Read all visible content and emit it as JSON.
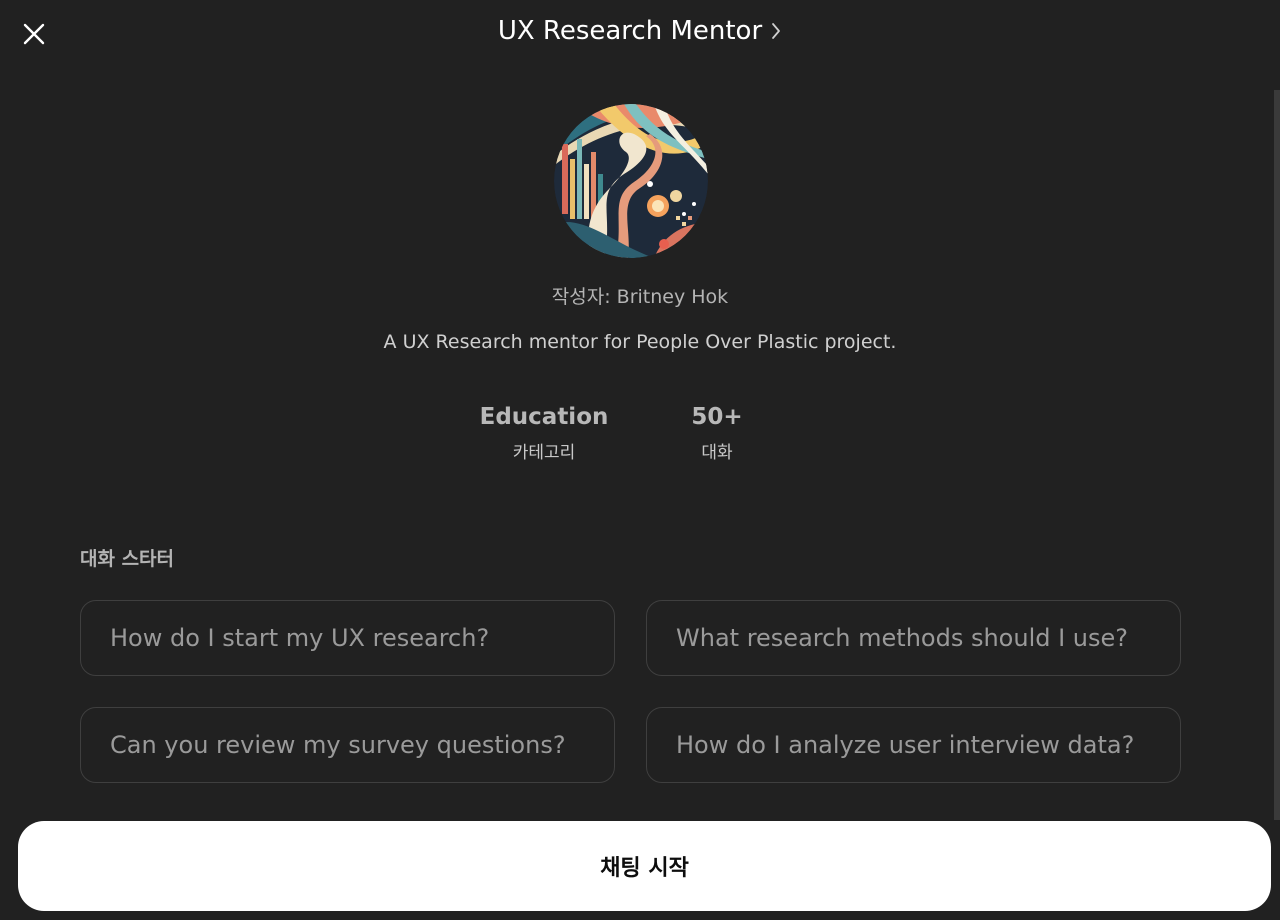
{
  "header": {
    "title": "UX Research Mentor",
    "close_icon": "close-icon",
    "chevron_icon": "chevron-right-icon"
  },
  "profile": {
    "avatar_icon": "abstract-art-avatar",
    "author": "작성자: Britney Hok",
    "description": "A UX Research mentor for People Over Plastic project."
  },
  "stats": [
    {
      "value": "Education",
      "label": "카테고리"
    },
    {
      "value": "50+",
      "label": "대화"
    }
  ],
  "starters": {
    "title": "대화 스타터",
    "items": [
      "How do I start my UX research?",
      "What research methods should I use?",
      "Can you review my survey questions?",
      "How do I analyze user interview data?"
    ]
  },
  "start_button": {
    "label": "채팅 시작"
  },
  "colors": {
    "background": "#212121",
    "button_bg": "#ffffff",
    "button_text": "#0d0d0d",
    "starter_border": "#3f3f3f"
  }
}
